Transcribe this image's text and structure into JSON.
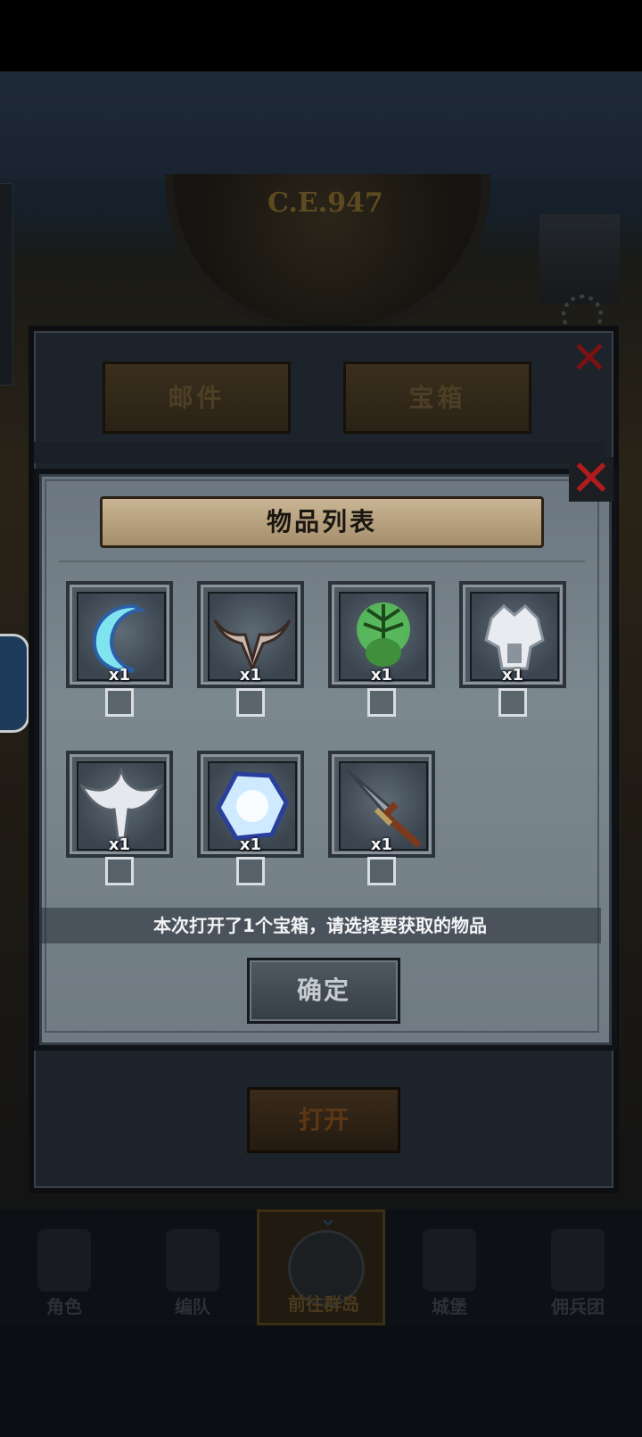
{
  "background": {
    "year_label": "C.E.947"
  },
  "back_panel": {
    "tabs": [
      {
        "label": "邮件"
      },
      {
        "label": "宝箱"
      }
    ],
    "open_button": "打开"
  },
  "dialog": {
    "title": "物品列表",
    "items": [
      {
        "icon": "crescent-blade-icon",
        "qty": "x1",
        "checked": false
      },
      {
        "icon": "horned-mask-icon",
        "qty": "x1",
        "checked": false
      },
      {
        "icon": "tree-skull-icon",
        "qty": "x1",
        "checked": false
      },
      {
        "icon": "crystal-skull-icon",
        "qty": "x1",
        "checked": false
      },
      {
        "icon": "winged-emblem-icon",
        "qty": "x1",
        "checked": false
      },
      {
        "icon": "blue-crystal-icon",
        "qty": "x1",
        "checked": false
      },
      {
        "icon": "sword-icon",
        "qty": "x1",
        "checked": false
      }
    ],
    "info_text": "本次打开了1个宝箱，请选择要获取的物品",
    "confirm_button": "确定"
  },
  "bottom_nav": {
    "items": [
      {
        "label": "角色",
        "active": false
      },
      {
        "label": "编队",
        "active": false
      },
      {
        "label": "前往群岛",
        "active": true
      },
      {
        "label": "城堡",
        "active": false
      },
      {
        "label": "佣兵团",
        "active": false
      }
    ]
  }
}
